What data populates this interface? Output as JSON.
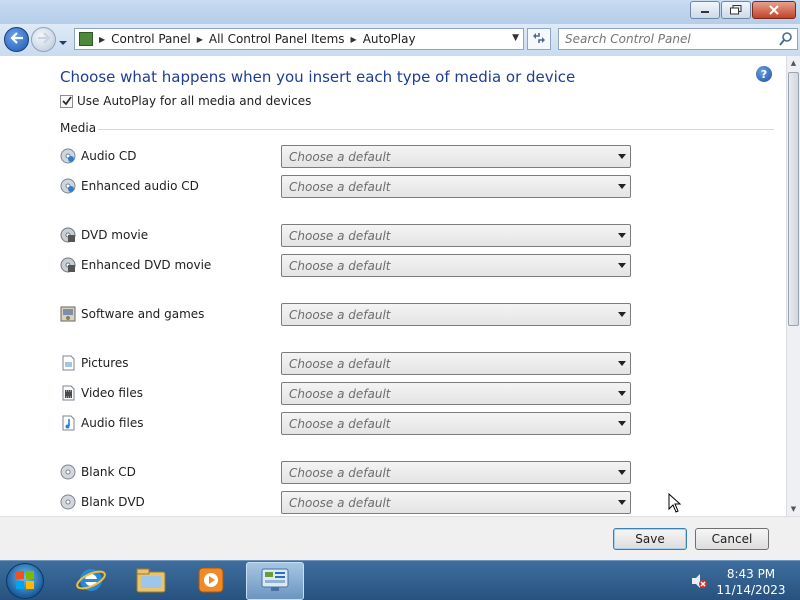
{
  "window": {
    "caption_buttons": [
      "minimize-icon",
      "restore-icon",
      "close-icon"
    ]
  },
  "navbar": {
    "breadcrumbs": [
      "Control Panel",
      "All Control Panel Items",
      "AutoPlay"
    ],
    "search_placeholder": "Search Control Panel"
  },
  "main": {
    "heading": "Choose what happens when you insert each type of media or device",
    "help_glyph": "?",
    "use_autoplay_label": "Use AutoPlay for all media and devices",
    "use_autoplay_checked": true,
    "section_title": "Media",
    "select_default": "Choose a default",
    "media_items": [
      {
        "label": "Audio CD",
        "icon": "audio-cd-icon",
        "value": "Choose a default"
      },
      {
        "label": "Enhanced audio CD",
        "icon": "enhanced-audio-cd-icon",
        "value": "Choose a default"
      },
      {
        "label": "DVD movie",
        "icon": "dvd-movie-icon",
        "value": "Choose a default"
      },
      {
        "label": "Enhanced DVD movie",
        "icon": "enhanced-dvd-movie-icon",
        "value": "Choose a default"
      },
      {
        "label": "Software and games",
        "icon": "software-games-icon",
        "value": "Choose a default"
      },
      {
        "label": "Pictures",
        "icon": "pictures-icon",
        "value": "Choose a default"
      },
      {
        "label": "Video files",
        "icon": "video-files-icon",
        "value": "Choose a default"
      },
      {
        "label": "Audio files",
        "icon": "audio-files-icon",
        "value": "Choose a default"
      },
      {
        "label": "Blank CD",
        "icon": "blank-cd-icon",
        "value": "Choose a default"
      },
      {
        "label": "Blank DVD",
        "icon": "blank-dvd-icon",
        "value": "Choose a default"
      }
    ]
  },
  "footer": {
    "save_label": "Save",
    "cancel_label": "Cancel"
  },
  "taskbar": {
    "items": [
      "internet-explorer-icon",
      "windows-explorer-icon",
      "media-player-icon",
      "control-panel-icon"
    ],
    "active_item": "control-panel-icon",
    "clock_time": "8:43 PM",
    "clock_date": "11/14/2023",
    "tray_icons": [
      "volume-muted-icon"
    ]
  },
  "colors": {
    "heading": "#1e3e96",
    "window_frame": "#dbe7f5",
    "taskbar": "#27527f"
  }
}
